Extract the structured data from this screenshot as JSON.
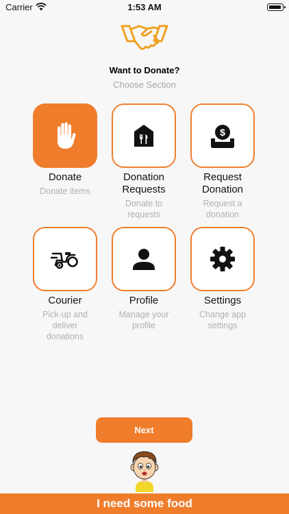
{
  "status_bar": {
    "carrier": "Carrier",
    "time": "1:53 AM"
  },
  "header": {
    "title": "Want to Donate?",
    "subtitle": "Choose Section",
    "logo_icon": "handshake-icon"
  },
  "accent_color": "#f07d2c",
  "tiles": [
    {
      "label": "Donate",
      "desc": "Donate items",
      "icon": "hand-icon",
      "active": true
    },
    {
      "label": "Donation\nRequests",
      "desc": "Donate to\nrequests",
      "icon": "food-bank-icon",
      "active": false
    },
    {
      "label": "Request\nDonation",
      "desc": "Request a\ndonation",
      "icon": "money-donation-icon",
      "active": false
    },
    {
      "label": "Courier",
      "desc": "Pick-up and\ndeliver\ndonations",
      "icon": "delivery-scooter-icon",
      "active": false
    },
    {
      "label": "Profile",
      "desc": "Manage your\nprofile",
      "icon": "person-icon",
      "active": false
    },
    {
      "label": "Settings",
      "desc": "Change app\nsettings",
      "icon": "gear-icon",
      "active": false
    }
  ],
  "next_button": {
    "label": "Next"
  },
  "banner": {
    "text": "I need some food"
  }
}
